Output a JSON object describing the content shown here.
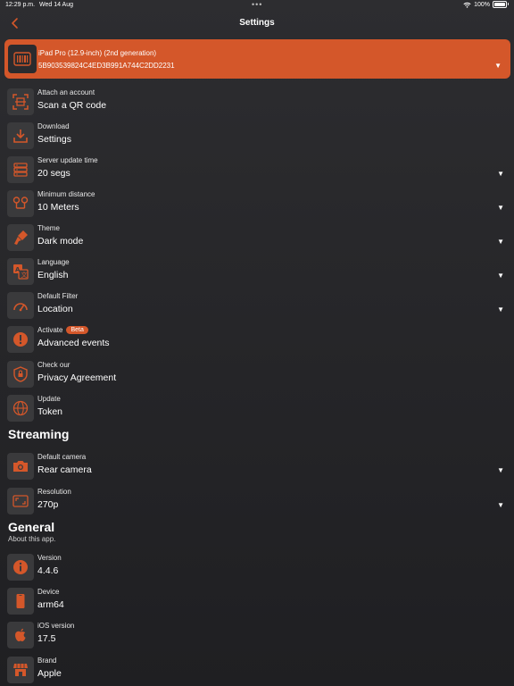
{
  "status_bar": {
    "time": "12:29 p.m.",
    "date": "Wed 14 Aug",
    "dots": "•••",
    "battery": "100%"
  },
  "nav": {
    "title": "Settings",
    "back_icon": "chevron-left-icon"
  },
  "device": {
    "name": "iPad Pro (12.9-inch) (2nd generation)",
    "serial": "5B903539824C4ED3B991A744C2DD2231",
    "icon": "barcode-icon"
  },
  "colors": {
    "accent": "#d4572a",
    "background": "#2a2a2d",
    "icon_box": "#3a3a3c"
  },
  "settings": [
    {
      "label": "Attach an account",
      "value": "Scan a QR code",
      "icon": "qr-scan-icon"
    },
    {
      "label": "Download",
      "value": "Settings",
      "icon": "download-icon"
    },
    {
      "label": "Server update time",
      "value": "20 segs",
      "icon": "server-icon"
    },
    {
      "label": "Minimum distance",
      "value": "10 Meters",
      "icon": "route-icon"
    },
    {
      "label": "Theme",
      "value": "Dark mode",
      "icon": "paintbrush-icon"
    },
    {
      "label": "Language",
      "value": "English",
      "icon": "translate-icon"
    },
    {
      "label": "Default Filter",
      "value": "Location",
      "icon": "gauge-icon"
    },
    {
      "label": "Activate",
      "badge": "Beta",
      "value": "Advanced events",
      "icon": "alert-icon"
    },
    {
      "label": "Check our",
      "value": "Privacy Agreement",
      "icon": "shield-lock-icon"
    },
    {
      "label": "Update",
      "value": "Token",
      "icon": "globe-icon"
    }
  ],
  "streaming": {
    "title": "Streaming",
    "items": [
      {
        "label": "Default camera",
        "value": "Rear camera",
        "icon": "camera-icon"
      },
      {
        "label": "Resolution",
        "value": "270p",
        "icon": "resize-icon"
      }
    ]
  },
  "general": {
    "title": "General",
    "subtitle": "About this app.",
    "items": [
      {
        "label": "Version",
        "value": "4.4.6",
        "icon": "info-icon"
      },
      {
        "label": "Device",
        "value": "arm64",
        "icon": "phone-icon"
      },
      {
        "label": "iOS version",
        "value": "17.5",
        "icon": "apple-icon"
      },
      {
        "label": "Brand",
        "value": "Apple",
        "icon": "store-icon"
      }
    ]
  }
}
